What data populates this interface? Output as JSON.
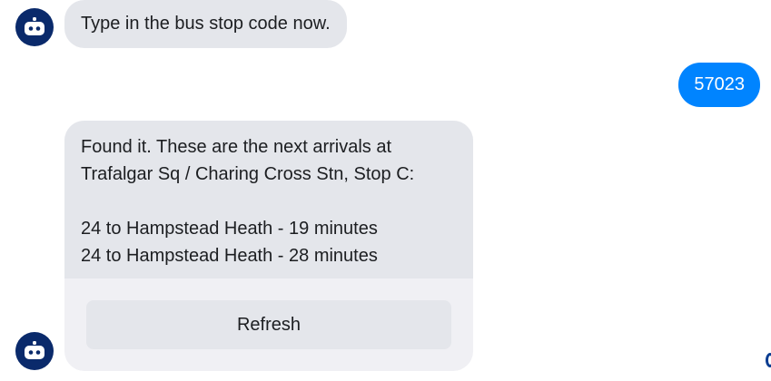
{
  "messages": {
    "bot_prompt": "Type in the bus stop code now.",
    "user_reply": "57023",
    "arrivals": {
      "text": "Found it. These are the next arrivals at\nTrafalgar Sq / Charing Cross Stn, Stop C:\n\n24 to Hampstead Heath - 19 minutes\n24 to Hampstead Heath - 28 minutes",
      "button_label": "Refresh"
    }
  },
  "icons": {
    "bot_avatar": "robot-icon",
    "edge": "scroll-indicator-icon"
  },
  "colors": {
    "incoming_bubble": "#e4e6eb",
    "outgoing_bubble": "#0084ff",
    "avatar_bg": "#0a2a6b",
    "text": "#1c1e21"
  }
}
